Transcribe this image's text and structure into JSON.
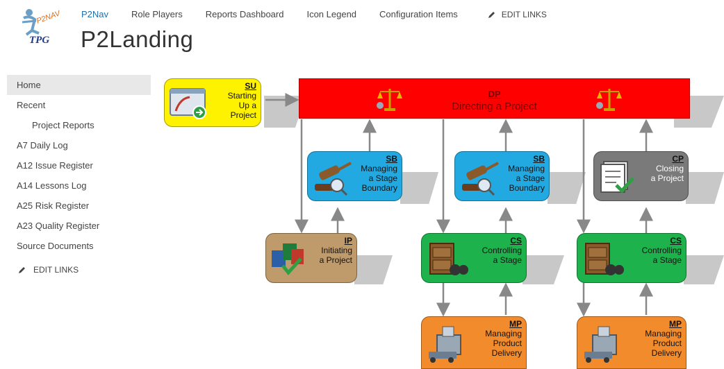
{
  "header": {
    "logo_text": [
      "P2NAV",
      "TPG"
    ],
    "title": "P2Landing",
    "nav": [
      "P2Nav",
      "Role Players",
      "Reports Dashboard",
      "Icon Legend",
      "Configuration Items"
    ],
    "edit_links": "EDIT LINKS"
  },
  "sidebar": {
    "items": [
      "Home",
      "Recent",
      "Project Reports",
      "A7 Daily Log",
      "A12 Issue Register",
      "A14 Lessons Log",
      "A25 Risk Register",
      "A23 Quality Register",
      "Source Documents"
    ],
    "edit_links": "EDIT LINKS"
  },
  "diagram": {
    "dp": {
      "code": "DP",
      "name": "Directing a Project"
    },
    "su": {
      "code": "SU",
      "lines": [
        "Starting",
        "Up a",
        "Project"
      ]
    },
    "sb1": {
      "code": "SB",
      "lines": [
        "Managing",
        "a Stage",
        "Boundary"
      ]
    },
    "sb2": {
      "code": "SB",
      "lines": [
        "Managing",
        "a Stage",
        "Boundary"
      ]
    },
    "cp": {
      "code": "CP",
      "lines": [
        "Closing",
        "a Project"
      ]
    },
    "ip": {
      "code": "IP",
      "lines": [
        "Initiating",
        "a Project"
      ]
    },
    "cs1": {
      "code": "CS",
      "lines": [
        "Controlling",
        "a Stage"
      ]
    },
    "cs2": {
      "code": "CS",
      "lines": [
        "Controlling",
        "a Stage"
      ]
    },
    "mp1": {
      "code": "MP",
      "lines": [
        "Managing",
        "Product",
        "Delivery"
      ]
    },
    "mp2": {
      "code": "MP",
      "lines": [
        "Managing",
        "Product",
        "Delivery"
      ]
    }
  },
  "colors": {
    "dp": "#ff0000",
    "su": "#fff200",
    "sb": "#22a9e1",
    "cp": "#7a7a7a",
    "ip": "#bf9a6b",
    "cs": "#1db24b",
    "mp": "#f28b2b",
    "link": "#1f6fa8"
  }
}
